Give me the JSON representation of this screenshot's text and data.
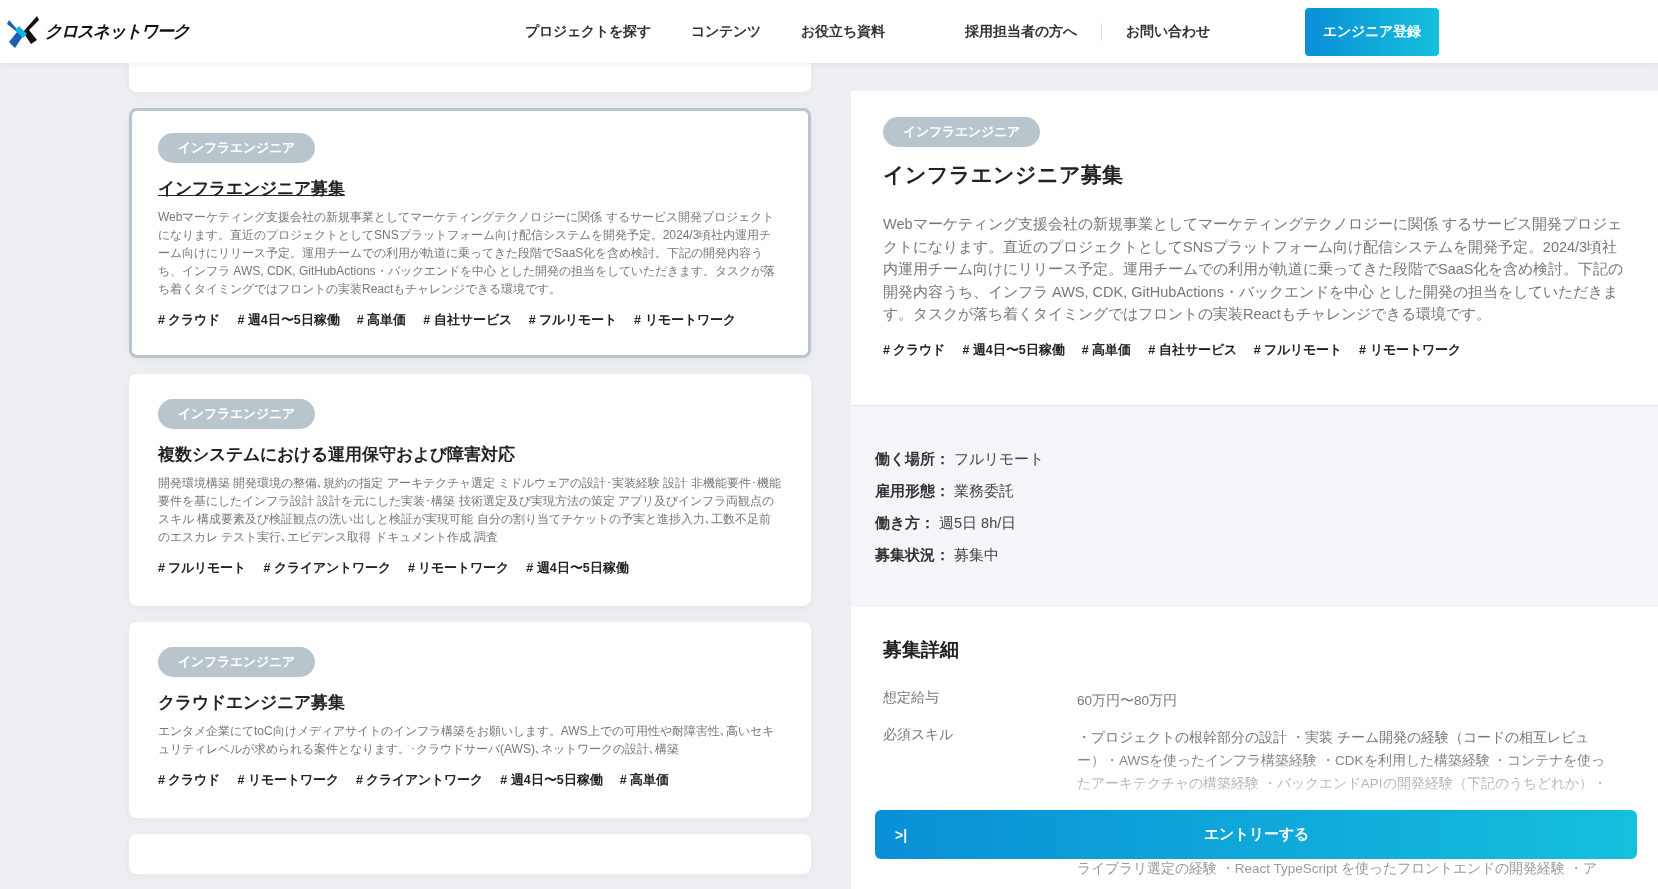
{
  "header": {
    "logo": "クロスネットワーク",
    "nav": [
      {
        "label": "プロジェクトを探す"
      },
      {
        "label": "コンテンツ"
      },
      {
        "label": "お役立ち資料"
      },
      {
        "label": "採用担当者の方へ"
      },
      {
        "label": "お問い合わせ"
      }
    ],
    "register_button": "エンジニア登録"
  },
  "cards": [
    {
      "category": "インフラエンジニア",
      "title": "インフラエンジニア募集",
      "selected": true,
      "description": "Webマーケティング支援会社の新規事業としてマーケティングテクノロジーに関係 するサービス開発プロジェクトになります。直近のプロジェクトとしてSNSプラットフォーム向け配信システムを開発予定。2024/3頃社内運用チーム向けにリリース予定。運用チームでの利用が軌道に乗ってきた段階でSaaS化を含め検討。下記の開発内容うち、インフラ AWS, CDK, GitHubActions・バックエンドを中心 とした開発の担当をしていただきます。タスクが落ち着くタイミングではフロントの実装Reactもチャレンジできる環境です。",
      "tags": [
        "# クラウド",
        "# 週4日〜5日稼働",
        "# 高単価",
        "# 自社サービス",
        "# フルリモート",
        "# リモートワーク"
      ]
    },
    {
      "category": "インフラエンジニア",
      "title": "複数システムにおける運用保守および障害対応",
      "selected": false,
      "description": "開発環境構築 開発環境の整備､規約の指定 アーキテクチャ選定 ミドルウェアの設計･実装経験 設計 非機能要件･機能要件を基にしたインフラ設計 設計を元にした実装･構築 技術選定及び実現方法の策定 アプリ及びインフラ両観点のスキル 構成要素及び検証観点の洗い出しと検証が実現可能 自分の割り当てチケットの予実と進捗入力､工数不足前のエスカレ テスト実行､エビデンス取得 ドキュメント作成 調査",
      "tags": [
        "# フルリモート",
        "# クライアントワーク",
        "# リモートワーク",
        "# 週4日〜5日稼働"
      ]
    },
    {
      "category": "インフラエンジニア",
      "title": "クラウドエンジニア募集",
      "selected": false,
      "description": "エンタメ企業にてtoC向けメディアサイトのインフラ構築をお願いします。AWS上での可用性や耐障害性､高いセキュリティレベルが求められる案件となります。･クラウドサーバ(AWS)､ネットワークの設計､構築",
      "tags": [
        "# クラウド",
        "# リモートワーク",
        "# クライアントワーク",
        "# 週4日〜5日稼働",
        "# 高単価"
      ]
    }
  ],
  "detail": {
    "category": "インフラエンジニア",
    "title": "インフラエンジニア募集",
    "description": "Webマーケティング支援会社の新規事業としてマーケティングテクノロジーに関係 するサービス開発プロジェクトになります。直近のプロジェクトとしてSNSプラットフォーム向け配信システムを開発予定。2024/3頃社内運用チーム向けにリリース予定。運用チームでの利用が軌道に乗ってきた段階でSaaS化を含め検討。下記の開発内容うち、インフラ AWS, CDK, GitHubActions・バックエンドを中心 とした開発の担当をしていただきます。タスクが落ち着くタイミングではフロントの実装Reactもチャレンジできる環境です。",
    "tags": [
      "# クラウド",
      "# 週4日〜5日稼働",
      "# 高単価",
      "# 自社サービス",
      "# フルリモート",
      "# リモートワーク"
    ],
    "conditions": [
      {
        "label": "働く場所：",
        "value": "フルリモート"
      },
      {
        "label": "雇用形態：",
        "value": "業務委託"
      },
      {
        "label": "働き方：",
        "value": "週5日 8h/日"
      },
      {
        "label": "募集状況：",
        "value": "募集中"
      }
    ],
    "details_title": "募集詳細",
    "requirements": [
      {
        "label": "想定給与",
        "value": "60万円〜80万円"
      },
      {
        "label": "必須スキル",
        "value": "・プロジェクトの根幹部分の設計 ・実装 チーム開発の経験（コードの相互レビュー）・AWSを使ったインフラ構築経験 ・CDKを利用した構築経験 ・コンテナを使ったアーキテクチャの構築経験 ・バックエンドAPIの開発経験（下記のうちどれか）・"
      }
    ],
    "requirement_tail": "ライブラリ選定の経験 ・React TypeScript を使ったフロントエンドの開発経験 ・ア",
    "entry_button": {
      "icon": ">|",
      "label": "エントリーする"
    }
  }
}
